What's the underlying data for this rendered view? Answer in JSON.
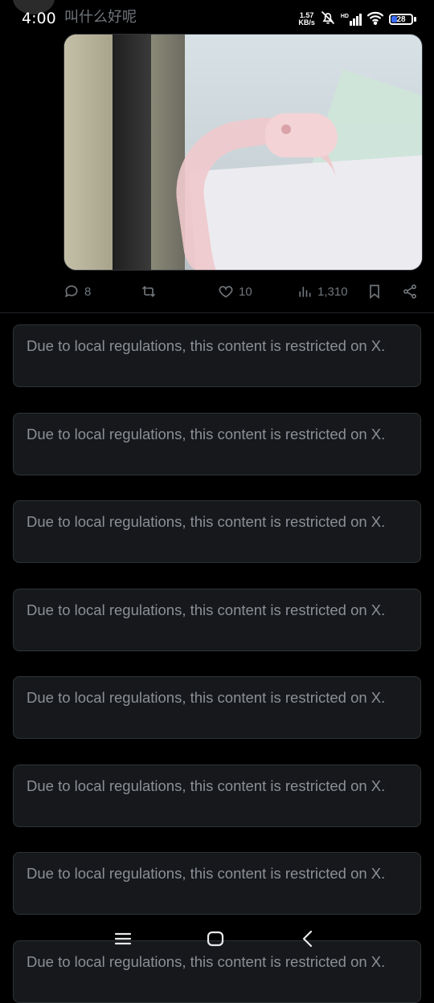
{
  "status_bar": {
    "time": "4:00",
    "network_speed_value": "1.57",
    "network_speed_unit": "KB/s",
    "hd_label": "HD",
    "battery_level": "28",
    "icons": [
      "mute-bell-icon",
      "hd-signal-icon",
      "wifi-icon",
      "battery-icon"
    ]
  },
  "post": {
    "author_name": "叫什么好呢",
    "media_description_icon": "photo",
    "actions": {
      "replies": "8",
      "likes": "10",
      "views": "1,310"
    }
  },
  "restricted_notices": [
    "Due to local regulations, this content is restricted on X.",
    "Due to local regulations, this content is restricted on X.",
    "Due to local regulations, this content is restricted on X.",
    "Due to local regulations, this content is restricted on X.",
    "Due to local regulations, this content is restricted on X.",
    "Due to local regulations, this content is restricted on X.",
    "Due to local regulations, this content is restricted on X.",
    "Due to local regulations, this content is restricted on X."
  ],
  "nav_bar": {
    "icons": [
      "menu-icon",
      "home-icon",
      "back-icon"
    ]
  },
  "colors": {
    "background": "#000000",
    "card": "#16181c",
    "card_border": "#2f3336",
    "muted_text": "#71767b",
    "notice_text": "#8b9096",
    "battery_accent": "#3b6cf6"
  }
}
